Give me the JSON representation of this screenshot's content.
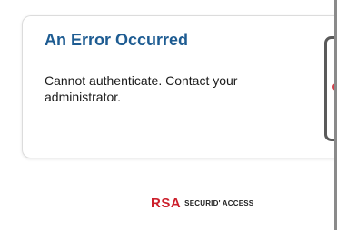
{
  "error_card": {
    "title": "An Error Occurred",
    "message": "Cannot authenticate. Contact your administrator."
  },
  "footer": {
    "logo_mark": "RSA",
    "logo_product": "SECURID' ACCESS"
  },
  "colors": {
    "title_color": "#1e5c92",
    "brand_red": "#cc1f2b"
  },
  "icons": {
    "phone_illustration": "phone-icon"
  }
}
